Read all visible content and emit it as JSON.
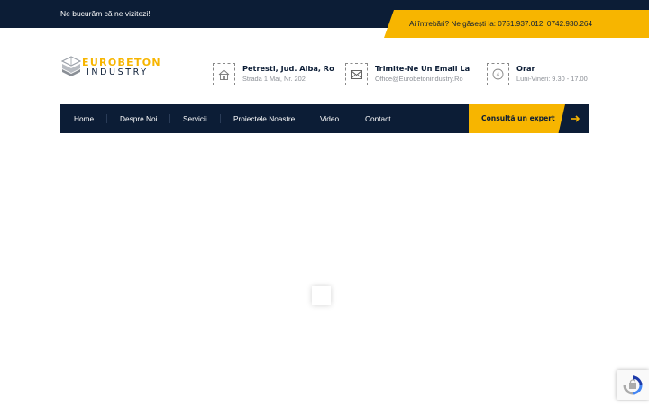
{
  "topbar": {
    "welcome": "Ne bucurăm că ne vizitezi!",
    "contact": "Ai întrebări? Ne găsești la: 0751.937.012, 0742.930.264"
  },
  "logo": {
    "line1": "EUROBETON",
    "line2": "INDUSTRY"
  },
  "info": [
    {
      "title": "Petresti, Jud. Alba, Ro",
      "subtitle": "Strada 1 Mai, Nr. 202",
      "icon": "home-icon"
    },
    {
      "title": "Trimite-Ne Un Email La",
      "subtitle": "Office@Eurobetonindustry.Ro",
      "icon": "envelope-icon"
    },
    {
      "title": "Orar",
      "subtitle": "Luni-Vineri: 9.30 - 17.00",
      "icon": "clock-icon"
    }
  ],
  "nav": {
    "items": [
      "Home",
      "Despre Noi",
      "Servicii",
      "Proiectele Noastre",
      "Video",
      "Contact"
    ],
    "cta": "Consultă un expert"
  },
  "colors": {
    "navy": "#0c1d36",
    "accent": "#f7b500"
  }
}
